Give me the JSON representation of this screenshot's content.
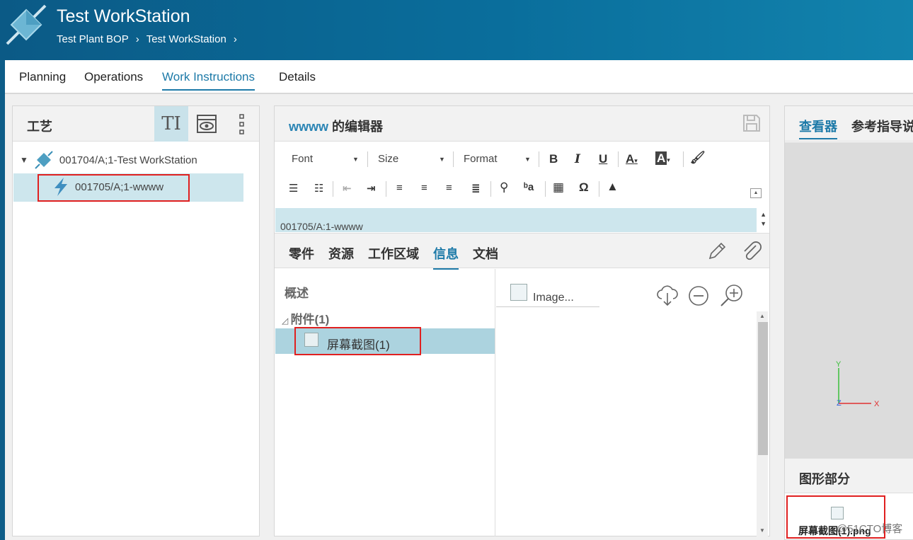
{
  "header": {
    "title": "Test WorkStation",
    "breadcrumbs": [
      "Test Plant BOP",
      "Test WorkStation"
    ]
  },
  "tabs": [
    "Planning",
    "Operations",
    "Work Instructions",
    "Details"
  ],
  "active_tab": "Work Instructions",
  "left_panel": {
    "title": "工艺",
    "tree": [
      {
        "label": "001704/A;1-Test WorkStation",
        "icon": "workstation-icon",
        "expanded": true
      },
      {
        "label": "001705/A;1-wwww",
        "icon": "operation-bolt-icon",
        "selected": true
      }
    ]
  },
  "editor": {
    "title_highlight": "wwww",
    "title_rest": " 的编辑器",
    "font_label": "Font",
    "size_label": "Size",
    "format_label": "Format",
    "path": "001705/A:1-wwww"
  },
  "subtabs": [
    "零件",
    "资源",
    "工作区域",
    "信息",
    "文档"
  ],
  "active_subtab": "信息",
  "info": {
    "overview": "概述",
    "attachments": "附件(1)",
    "attachment_item": "屏幕截图(1)",
    "image_caption": "Image..."
  },
  "right_panel": {
    "tabs": [
      "查看器",
      "参考指导说"
    ],
    "active_tab": "查看器",
    "axes": {
      "x": "X",
      "y": "Y",
      "z": "Z"
    },
    "graphics_title": "图形部分",
    "thumbnail_caption": "屏幕截图(1).png"
  },
  "watermark": "@51CTO博客",
  "colors": {
    "header": "#0a6e9c",
    "accent": "#1d7aa8",
    "selection": "#cde6ed",
    "highlight_box": "#e02020"
  }
}
